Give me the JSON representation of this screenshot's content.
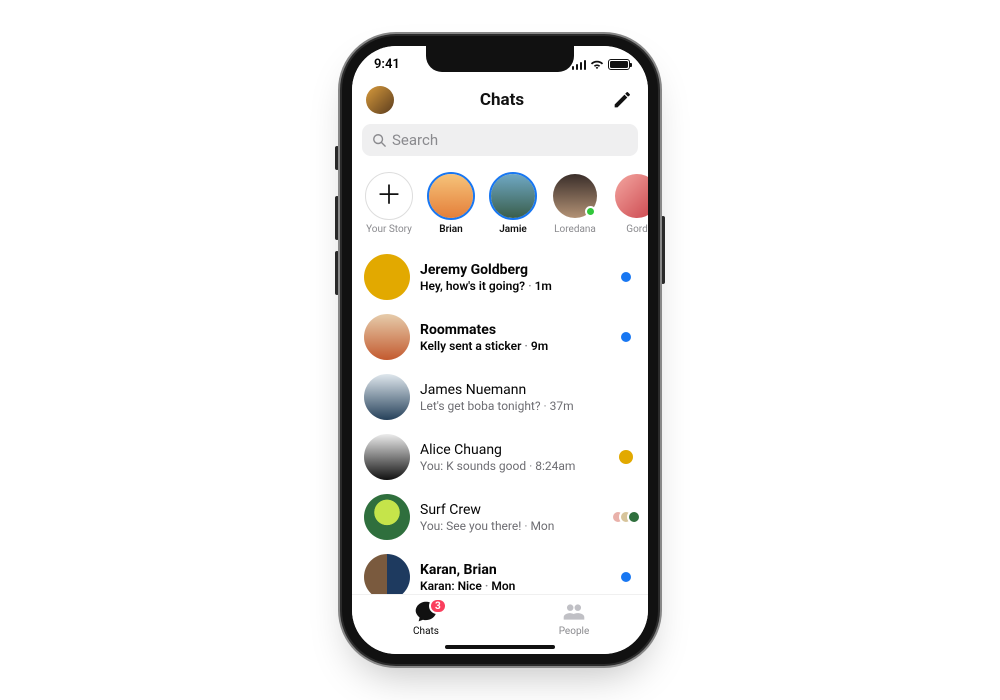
{
  "status": {
    "time": "9:41"
  },
  "header": {
    "title": "Chats"
  },
  "search": {
    "placeholder": "Search"
  },
  "stories": [
    {
      "label": "Your Story",
      "kind": "add"
    },
    {
      "label": "Brian",
      "kind": "unread",
      "palette": "p-sunset"
    },
    {
      "label": "Jamie",
      "kind": "unread",
      "palette": "p-mountain"
    },
    {
      "label": "Loredana",
      "kind": "presence",
      "palette": "p-woman"
    },
    {
      "label": "Gord",
      "kind": "plain",
      "palette": "p-pink"
    }
  ],
  "chats": [
    {
      "name": "Jeremy Goldberg",
      "preview": "Hey, how's it going?",
      "time": "1m",
      "unread": true,
      "palette": "p-yellow"
    },
    {
      "name": "Roommates",
      "preview": "Kelly sent a sticker",
      "time": "9m",
      "unread": true,
      "palette": "p-bridge"
    },
    {
      "name": "James Nuemann",
      "preview": "Let's get boba tonight?",
      "time": "37m",
      "unread": false,
      "palette": "p-guy"
    },
    {
      "name": "Alice Chuang",
      "preview": "You: K sounds good",
      "time": "8:24am",
      "unread": false,
      "palette": "p-violet",
      "seen": "single"
    },
    {
      "name": "Surf Crew",
      "preview": "You: See you there!",
      "time": "Mon",
      "unread": false,
      "palette": "p-surf",
      "seen": "stack"
    },
    {
      "name": "Karan, Brian",
      "preview": "Karan: Nice",
      "time": "Mon",
      "unread": true,
      "palette": "p-duo"
    }
  ],
  "tabbar": {
    "chats_label": "Chats",
    "people_label": "People",
    "badge": "3"
  }
}
